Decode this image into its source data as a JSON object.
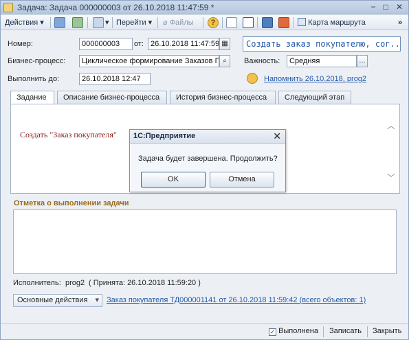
{
  "window": {
    "title": "Задача: Задача 000000003 от 26.10.2018 11:47:59 *",
    "controls": [
      "−",
      "□",
      "✕"
    ]
  },
  "toolbar": {
    "actions_label": "Действия",
    "goto_label": "Перейти",
    "files_label": "Файлы",
    "help_label": "?",
    "route_map_label": "Карта маршрута"
  },
  "form": {
    "number_label": "Номер:",
    "number_value": "000000003",
    "date_label": "от:",
    "date_value": "26.10.2018 11:47:59",
    "title_value": "Создать заказ покупателю, сог...",
    "process_label": "Бизнес-процесс:",
    "process_value": "Циклическое формирование Заказов Г",
    "importance_label": "Важность:",
    "importance_value": "Средняя",
    "due_label": "Выполнить до:",
    "due_value": "26.10.2018 12:47",
    "remind_link": "Напомнить 26.10.2018, prog2"
  },
  "tabs": [
    {
      "label": "Задание"
    },
    {
      "label": "Описание бизнес-процесса"
    },
    {
      "label": "История бизнес-процесса"
    },
    {
      "label": "Следующий этап"
    }
  ],
  "task_text": "Создать \"Заказ покупателя\"",
  "completion": {
    "section_title": "Отметка о выполнении задачи",
    "notes_value": ""
  },
  "executor": {
    "label": "Исполнитель:",
    "value": "prog2",
    "accepted": "( Принята: 26.10.2018 11:59:20 )"
  },
  "bottom": {
    "main_actions": "Основные действия",
    "order_link": "Заказ покупателя ТД000001141 от 26.10.2018 11:59:42 (всего объектов: 1)"
  },
  "statusbar": {
    "done_label": "Выполнена",
    "done_checked": true,
    "save_label": "Записать",
    "close_label": "Закрыть"
  },
  "dialog": {
    "title": "1С:Предприятие",
    "message": "Задача будет завершена. Продолжить?",
    "ok_label": "OK",
    "cancel_label": "Отмена"
  },
  "colors": {
    "accent": "#2559a9",
    "section_title": "#9a6b15",
    "task_text": "#8b1a1a"
  }
}
